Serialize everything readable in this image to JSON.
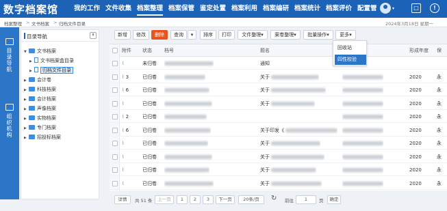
{
  "app": {
    "title": "数字档案馆"
  },
  "nav": {
    "items": [
      "我的工作",
      "文件收集",
      "档案整理",
      "档案保管",
      "鉴定处置",
      "档案利用",
      "档案编研",
      "档案统计",
      "档案评价",
      "配置管"
    ],
    "active_index": 2
  },
  "top_icons": [
    "user-avatar",
    "screen-icon",
    "bell-icon"
  ],
  "breadcrumb": {
    "items": [
      "档案整理",
      "文书档案",
      "归档文件目录"
    ],
    "date": "2024年3月18日 星期一"
  },
  "left_rail": {
    "items": [
      "目录导航",
      "组织机构"
    ]
  },
  "tree": {
    "title": "目录导航",
    "nodes": [
      {
        "label": "文书档案",
        "type": "folder",
        "expanded": true,
        "level": 0
      },
      {
        "label": "文书档案盒目录",
        "type": "file",
        "level": 1
      },
      {
        "label": "归档文件目录",
        "type": "file",
        "level": 1,
        "selected": true
      },
      {
        "label": "会计卷",
        "type": "folder",
        "level": 0
      },
      {
        "label": "科技档案",
        "type": "folder",
        "level": 0
      },
      {
        "label": "会计档案",
        "type": "folder",
        "level": 0
      },
      {
        "label": "声像档案",
        "type": "folder",
        "level": 0
      },
      {
        "label": "实物档案",
        "type": "folder",
        "level": 0
      },
      {
        "label": "专门档案",
        "type": "folder",
        "level": 0
      },
      {
        "label": "招投标档案",
        "type": "folder",
        "level": 0
      }
    ]
  },
  "toolbar": {
    "new_label": "新增",
    "edit_label": "修改",
    "delete_label": "删除",
    "query_label": "查询",
    "query_dropdown": "▾",
    "sort_label": "排序",
    "print_label": "打印",
    "file_organize_label": "文件整理▾",
    "volume_organize_label": "案卷整理▾",
    "batch_label": "批量操作▾",
    "more_label": "更多▾"
  },
  "more_menu": {
    "items": [
      "回收站",
      "四性校验"
    ],
    "highlighted_index": 1
  },
  "table": {
    "columns": [
      "附件",
      "状态",
      "档号",
      "题名",
      "形成年度",
      "保"
    ],
    "rows": [
      {
        "attach": "",
        "status": "未归卷",
        "title": "通知",
        "year": "",
        "retention": ""
      },
      {
        "attach": "3",
        "status": "已归卷",
        "title": "关于",
        "year": "2020",
        "retention": "永"
      },
      {
        "attach": "6",
        "status": "已归卷",
        "title": "关于",
        "year": "2020",
        "retention": "永"
      },
      {
        "attach": "",
        "status": "已归卷",
        "title": "关于",
        "year": "2020",
        "retention": "永"
      },
      {
        "attach": "2",
        "status": "已归卷",
        "title": "",
        "year": "2020",
        "retention": "永"
      },
      {
        "attach": "6",
        "status": "已归卷",
        "title": "关于印发《",
        "year": "2020",
        "retention": "永"
      },
      {
        "attach": "",
        "status": "已归卷",
        "title": "关于",
        "year": "2020",
        "retention": "永"
      },
      {
        "attach": "",
        "status": "已归卷",
        "title": "关于",
        "year": "2020",
        "retention": "永"
      },
      {
        "attach": "",
        "status": "已归卷",
        "title": "关于",
        "year": "2020",
        "retention": "永"
      },
      {
        "attach": "",
        "status": "已归卷",
        "title": "关于",
        "year": "2020",
        "retention": "永"
      }
    ]
  },
  "pager": {
    "detail_label": "详情",
    "total_label": "共 51 条",
    "prev_label": "上一页",
    "pages": [
      "1",
      "2",
      "3"
    ],
    "next_label": "下一页",
    "page_size": "20条/页",
    "goto_label": "前往",
    "goto_value": "1",
    "page_unit": "页",
    "confirm_label": "确定"
  }
}
